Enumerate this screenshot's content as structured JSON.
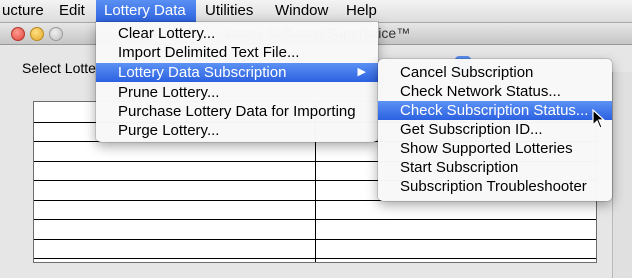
{
  "menubar": {
    "items": [
      "ucture",
      "Edit",
      "Lottery Data",
      "Utilities",
      "Window",
      "Help"
    ]
  },
  "window": {
    "title_fragment": "lottery Software/Superlotice™",
    "select_label": "Select Lotte"
  },
  "lottery_menu": {
    "items": [
      "Clear Lottery...",
      "Import Delimited Text File...",
      "Lottery Data Subscription",
      "Prune Lottery...",
      "Purchase Lottery Data for Importing",
      "Purge Lottery..."
    ],
    "submenu_arrow": "▶"
  },
  "subscription_menu": {
    "items": [
      "Cancel Subscription",
      "Check Network Status...",
      "Check Subscription Status...",
      "Get Subscription ID...",
      "Show Supported Lotteries",
      "Start Subscription",
      "Subscription Troubleshooter"
    ]
  },
  "colors": {
    "highlight": "#2f64e2",
    "menu_bg": "#f8f8f8"
  }
}
